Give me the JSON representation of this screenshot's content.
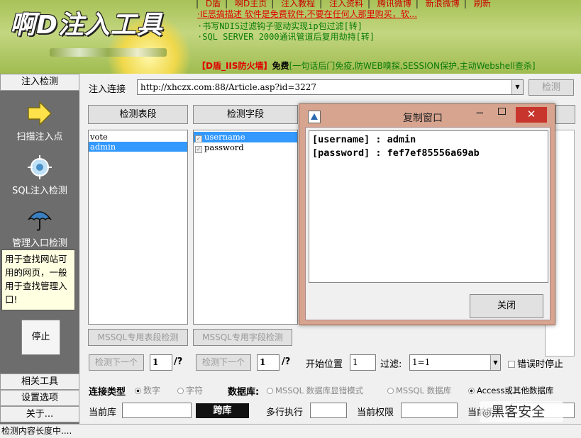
{
  "banner": {
    "logo": "啊D注入工具",
    "nav": [
      "D盾",
      "啊D主页",
      "注入教程",
      "注入资料",
      "腾讯微博",
      "新浪微博",
      "刷新"
    ],
    "notices": [
      "·IE恶搞描述 软件是免费软件,不要在任何人那里购买，软...",
      "·书写NDIS过滤钩子驱动实现ip包过滤[转]",
      "·SQL SERVER 2000通讯管道后复用劫持[转]"
    ],
    "ad": {
      "brand": "【D盾_IIS防火墙】",
      "free": "免费",
      "desc": "[一句话后门免疫,防WEB嗅探,SESSION保护,主动Webshell查杀]"
    }
  },
  "sidebar": {
    "header": "注入检测",
    "tools": [
      {
        "label": "扫描注入点",
        "icon": "arrow-right-icon"
      },
      {
        "label": "SQL注入检测",
        "icon": "crosshair-icon"
      },
      {
        "label": "管理入口检测",
        "icon": "umbrella-icon"
      }
    ],
    "tooltip": "用于查找网站可用的网页，一般用于查找管理入口!",
    "stop_label": "停止",
    "bottom": [
      "相关工具",
      "设置选项",
      "关于..."
    ]
  },
  "main": {
    "url_label": "注入连接",
    "url_value": "http://xhczx.com:88/Article.asp?id=3227",
    "check_btn": "检测",
    "detect_tables_btn": "检测表段",
    "detect_fields_btn": "检测字段",
    "tables": [
      "vote",
      "admin"
    ],
    "fields": [
      "username",
      "password"
    ],
    "mssql_table_btn": "MSSQL专用表段检测",
    "mssql_field_btn": "MSSQL专用字段检测",
    "next_btn": "检测下一个",
    "next_val": "1",
    "next_suffix": "/?",
    "start_pos_label": "开始位置",
    "start_pos_val": "1",
    "filter_label": "过滤:",
    "filter_val": "1=1",
    "stop_on_error": "错误时停止",
    "conn_type_label": "连接类型",
    "conn_opts": [
      "数字",
      "字符"
    ],
    "db_label": "数据库:",
    "db_opts": [
      "MSSQL 数据库显错模式",
      "MSSQL 数据库",
      "Access或其他数据库"
    ],
    "cur_db_label": "当前库",
    "jump_btn": "跨库",
    "multi_exec_label": "多行执行",
    "cur_perm_label": "当前权限",
    "cur_user_label": "当前用户"
  },
  "dialog": {
    "title": "复制窗口",
    "content": "[username] : admin\n[password] : fef7ef85556a69ab",
    "close_btn": "关闭"
  },
  "status": "检测内容长度中....",
  "watermark": "黑客安全",
  "colors": {
    "banner": "#a8c258",
    "sidebar": "#6d6d6d",
    "selection": "#3399ff",
    "dialog_frame": "#d7a490",
    "close_red": "#c8352c"
  }
}
